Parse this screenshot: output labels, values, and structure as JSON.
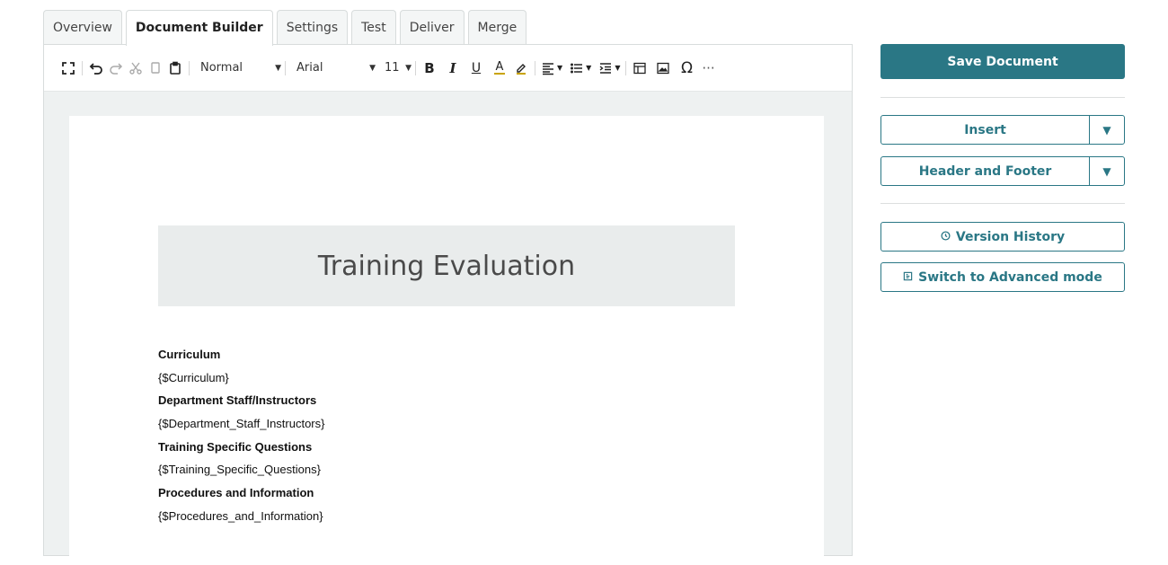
{
  "tabs": [
    "Overview",
    "Document Builder",
    "Settings",
    "Test",
    "Deliver",
    "Merge"
  ],
  "active_tab": "Document Builder",
  "toolbar": {
    "paragraph_style": "Normal",
    "font_family": "Arial",
    "font_size": "11",
    "bold": "B",
    "italic": "I",
    "underline": "U",
    "font_color": "A",
    "special_char": "Ω",
    "more": "···"
  },
  "document": {
    "title": "Training Evaluation",
    "lines": [
      {
        "text": "Curriculum",
        "bold": true
      },
      {
        "text": "{$Curriculum}",
        "bold": false
      },
      {
        "text": "Department Staff/Instructors",
        "bold": true
      },
      {
        "text": "{$Department_Staff_Instructors}",
        "bold": false
      },
      {
        "text": "Training Specific Questions",
        "bold": true
      },
      {
        "text": "{$Training_Specific_Questions}",
        "bold": false
      },
      {
        "text": "Procedures and Information",
        "bold": true
      },
      {
        "text": "{$Procedures_and_Information}",
        "bold": false
      }
    ]
  },
  "side": {
    "save_label": "Save Document",
    "insert_label": "Insert",
    "header_footer_label": "Header and Footer",
    "version_history_label": "Version History",
    "advanced_mode_label": "Switch to Advanced mode"
  },
  "colors": {
    "accent": "#2a7785",
    "banner_bg": "#e9ecec",
    "editor_bg": "#eef1f1"
  }
}
